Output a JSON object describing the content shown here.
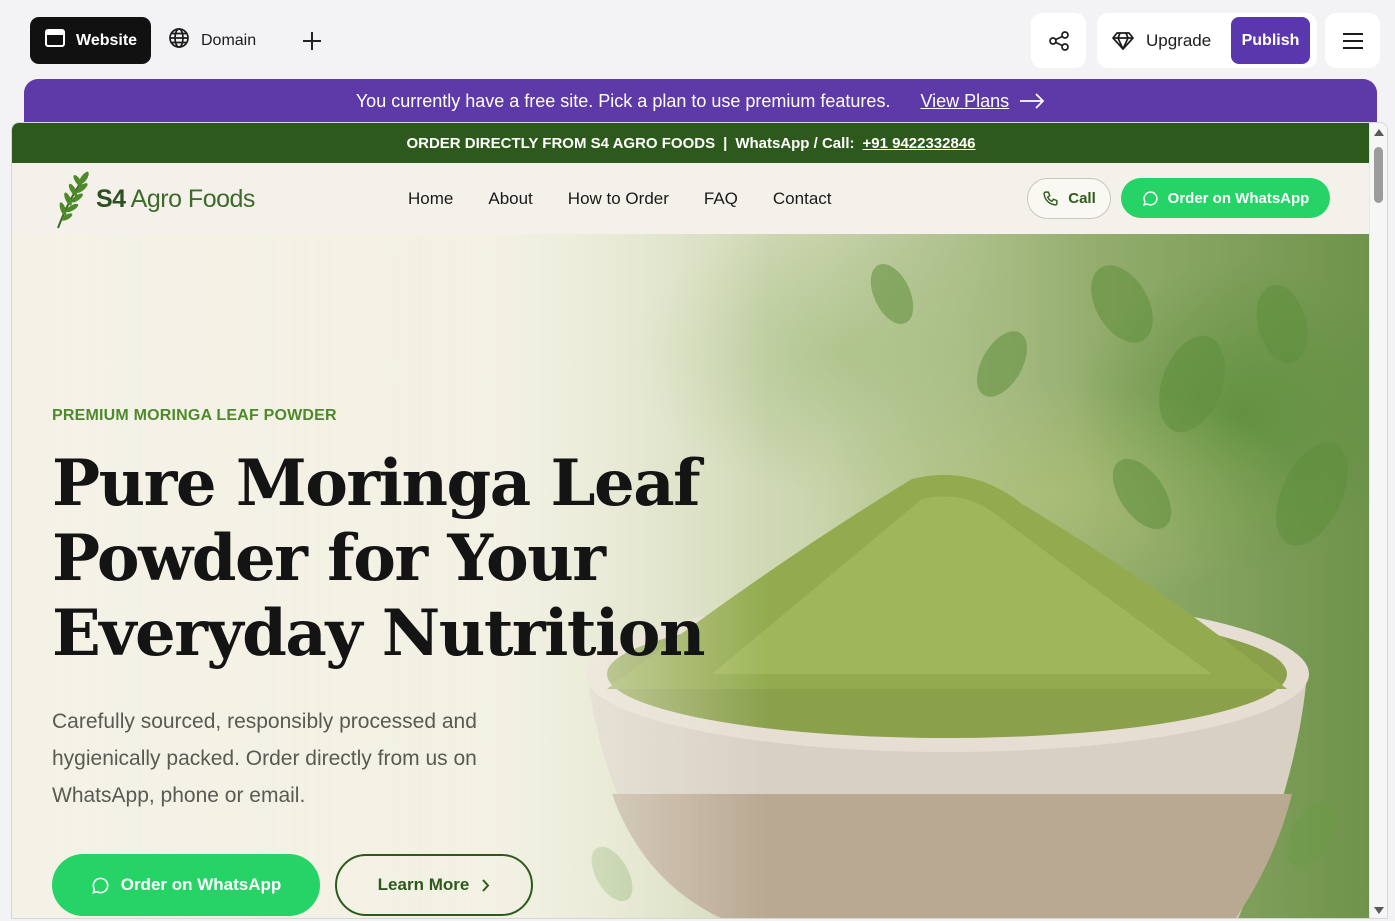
{
  "editor": {
    "tabs": [
      {
        "label": "Website",
        "icon": "browser-window-icon"
      },
      {
        "label": "Domain",
        "icon": "globe-icon"
      }
    ],
    "upgrade_label": "Upgrade",
    "publish_label": "Publish"
  },
  "notice": {
    "text": "You currently have a free site. Pick a plan to use premium features.",
    "link_label": "View Plans"
  },
  "site": {
    "announcement": {
      "prefix": "ORDER DIRECTLY FROM S4 AGRO FOODS",
      "separator": "|",
      "contact_label": "WhatsApp / Call:",
      "phone": "+91 9422332846"
    },
    "brand": {
      "name_part1": "S4",
      "name_part2": "Agro Foods"
    },
    "nav": [
      "Home",
      "About",
      "How to Order",
      "FAQ",
      "Contact"
    ],
    "call_label": "Call",
    "whatsapp_label": "Order on WhatsApp",
    "hero": {
      "eyebrow": "PREMIUM MORINGA LEAF POWDER",
      "headline": "Pure Moringa Leaf Powder for Your Everyday Nutrition",
      "subtext": "Carefully sourced, responsibly processed and hygienically packed. Order directly from us on WhatsApp, phone or email.",
      "primary_cta": "Order on WhatsApp",
      "secondary_cta": "Learn More"
    }
  },
  "colors": {
    "editor_dark": "#111111",
    "publish_purple": "#5b37ad",
    "notice_purple": "#5d3aa8",
    "brand_green": "#2d5a1c",
    "whatsapp_green": "#25d366",
    "eyebrow_green": "#4e8a2c"
  }
}
